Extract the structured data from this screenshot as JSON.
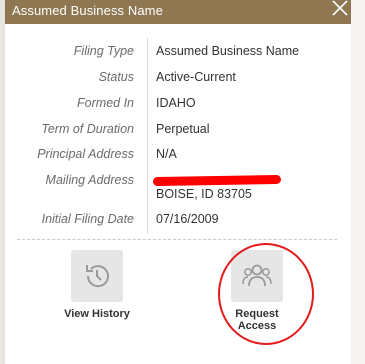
{
  "header": {
    "title": "Assumed Business Name"
  },
  "details": [
    {
      "label": "Filing Type",
      "value": "Assumed Business Name"
    },
    {
      "label": "Status",
      "value": "Active-Current"
    },
    {
      "label": "Formed In",
      "value": "IDAHO"
    },
    {
      "label": "Term of Duration",
      "value": "Perpetual"
    },
    {
      "label": "Principal Address",
      "value": "N/A"
    },
    {
      "label": "Mailing Address",
      "value_line2": "BOISE, ID 83705"
    },
    {
      "label": "Initial Filing Date",
      "value": "07/16/2009"
    }
  ],
  "actions": {
    "history_label": "View History",
    "request_label": "Request Access"
  }
}
